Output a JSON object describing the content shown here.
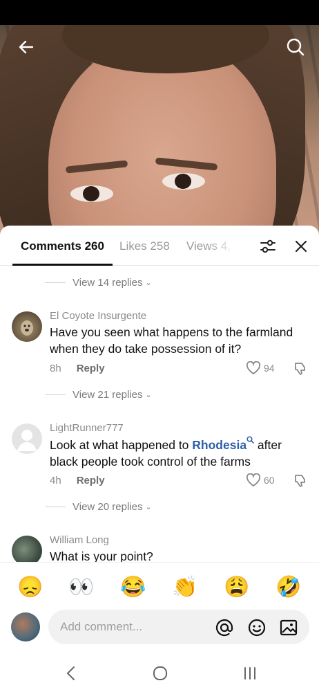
{
  "tabs": {
    "comments": "Comments 260",
    "likes": "Likes 258",
    "views": "Views 4,"
  },
  "comments": [
    {
      "username": "El Coyote Insurgente",
      "text": "Have you seen what happens to the farmland when they do take possession of it?",
      "time": "8h",
      "reply_label": "Reply",
      "likes": "94",
      "view_replies": "View 21 replies"
    },
    {
      "username": "LightRunner777",
      "text_before": "Look at what happened to ",
      "link": "Rhodesia",
      "text_after": " after black people took control of the farms",
      "time": "4h",
      "reply_label": "Reply",
      "likes": "60",
      "view_replies": "View 20 replies"
    },
    {
      "username": "William Long",
      "text": "What is your point?"
    }
  ],
  "previous_replies": "View 14 replies",
  "emojis": [
    "😞",
    "👀",
    "😂",
    "👏",
    "😩",
    "🤣"
  ],
  "input": {
    "placeholder": "Add comment..."
  },
  "colors": {
    "link": "#2f5fa8",
    "muted": "#8a8a8a",
    "text": "#111111"
  }
}
